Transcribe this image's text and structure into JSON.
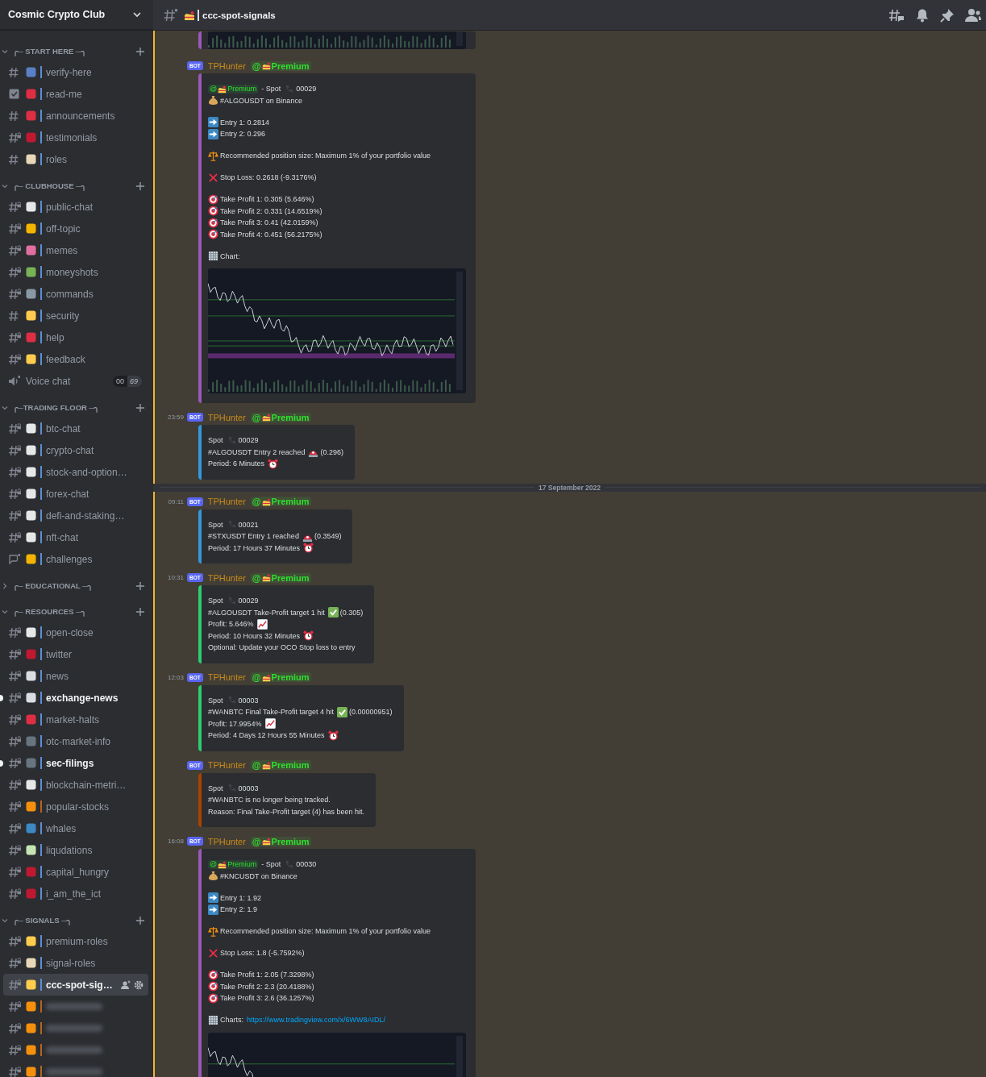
{
  "server": {
    "name": "Cosmic Crypto Club"
  },
  "sidebar": {
    "categories": [
      {
        "name": "╭─ START HERE ─╮",
        "expanded": true,
        "channels": [
          {
            "kind": "text",
            "name": "verify-here",
            "private": false,
            "unread": false,
            "selected": false
          },
          {
            "kind": "rules",
            "name": "read-me",
            "unread": false,
            "selected": false
          },
          {
            "kind": "text",
            "name": "announcements",
            "private": false,
            "unread": false,
            "selected": false
          },
          {
            "kind": "text",
            "name": "testimonials",
            "private": true,
            "unread": false,
            "selected": false
          },
          {
            "kind": "text",
            "name": "roles",
            "private": false,
            "unread": false,
            "selected": false
          }
        ]
      },
      {
        "name": "╭─ CLUBHOUSE ─╮",
        "expanded": true,
        "channels": [
          {
            "kind": "text",
            "name": "public-chat",
            "private": true,
            "unread": false,
            "selected": false
          },
          {
            "kind": "text",
            "name": "off-topic",
            "private": true,
            "unread": false,
            "selected": false
          },
          {
            "kind": "text",
            "name": "memes",
            "private": true,
            "unread": false,
            "selected": false
          },
          {
            "kind": "text",
            "name": "moneyshots",
            "private": true,
            "unread": false,
            "selected": false
          },
          {
            "kind": "text",
            "name": "commands",
            "private": true,
            "unread": false,
            "selected": false
          },
          {
            "kind": "text",
            "name": "security",
            "private": false,
            "unread": false,
            "selected": false
          },
          {
            "kind": "text",
            "name": "help",
            "private": true,
            "unread": false,
            "selected": false
          },
          {
            "kind": "text",
            "name": "feedback",
            "private": true,
            "unread": false,
            "selected": false
          },
          {
            "kind": "voice",
            "name": "Voice chat",
            "private": true,
            "unread": false,
            "selected": false,
            "user_count": "00",
            "user_limit": "69"
          }
        ]
      },
      {
        "name": "╭─TRADING FLOOR ─╮",
        "expanded": true,
        "channels": [
          {
            "kind": "text",
            "name": "btc-chat",
            "private": true,
            "unread": false,
            "selected": false
          },
          {
            "kind": "text",
            "name": "crypto-chat",
            "private": true,
            "unread": false,
            "selected": false
          },
          {
            "kind": "text",
            "name": "stock-and-option…",
            "private": true,
            "unread": false,
            "selected": false
          },
          {
            "kind": "text",
            "name": "forex-chat",
            "private": true,
            "unread": false,
            "selected": false
          },
          {
            "kind": "text",
            "name": "defi-and-staking…",
            "private": true,
            "unread": false,
            "selected": false
          },
          {
            "kind": "text",
            "name": "nft-chat",
            "private": true,
            "unread": false,
            "selected": false
          },
          {
            "kind": "forum",
            "name": "challenges",
            "private": true,
            "unread": false,
            "selected": false
          }
        ]
      },
      {
        "name": "╭─ EDUCATIONAL ─╮",
        "expanded": false
      },
      {
        "name": "╭─ RESOURCES ─╮",
        "expanded": true,
        "channels": [
          {
            "kind": "text",
            "name": "open-close",
            "private": true,
            "unread": false,
            "selected": false
          },
          {
            "kind": "text",
            "name": "twitter",
            "private": true,
            "unread": false,
            "selected": false
          },
          {
            "kind": "text",
            "name": "news",
            "private": true,
            "unread": false,
            "selected": false
          },
          {
            "kind": "text",
            "name": "exchange-news",
            "private": true,
            "unread": true,
            "selected": false
          },
          {
            "kind": "text",
            "name": "market-halts",
            "private": true,
            "unread": false,
            "selected": false
          },
          {
            "kind": "text",
            "name": "otc-market-info",
            "private": true,
            "unread": false,
            "selected": false
          },
          {
            "kind": "text",
            "name": "sec-filings",
            "private": true,
            "unread": true,
            "selected": false
          },
          {
            "kind": "text",
            "name": "blockchain-metri…",
            "private": true,
            "unread": false,
            "selected": false
          },
          {
            "kind": "text",
            "name": "popular-stocks",
            "private": true,
            "unread": false,
            "selected": false
          },
          {
            "kind": "text",
            "name": "whales",
            "private": true,
            "unread": false,
            "selected": false
          },
          {
            "kind": "text",
            "name": "liqudations",
            "private": true,
            "unread": false,
            "selected": false
          },
          {
            "kind": "text",
            "name": "capital_hungry",
            "private": true,
            "unread": false,
            "selected": false
          },
          {
            "kind": "text",
            "name": "i_am_the_ict",
            "private": true,
            "unread": false,
            "selected": false
          }
        ]
      },
      {
        "name": "╭─ SIGNALS ─╮",
        "expanded": true,
        "channels": [
          {
            "kind": "text",
            "name": "premium-roles",
            "private": true,
            "unread": false,
            "selected": false
          },
          {
            "kind": "text",
            "name": "signal-roles",
            "private": true,
            "unread": false,
            "selected": false
          },
          {
            "kind": "text",
            "name": "ccc-spot-sig…",
            "private": true,
            "unread": false,
            "selected": true
          },
          {
            "kind": "text",
            "blurred": true,
            "private": true,
            "unread": false,
            "selected": false
          },
          {
            "kind": "text",
            "blurred": true,
            "private": true,
            "unread": false,
            "selected": false
          },
          {
            "kind": "text",
            "blurred": true,
            "private": true,
            "unread": false,
            "selected": false
          },
          {
            "kind": "text",
            "blurred": true,
            "private": true,
            "unread": false,
            "selected": false
          }
        ]
      }
    ]
  },
  "channel_header": {
    "title": "ccc-spot-signals"
  },
  "messages": [
    {
      "kind": "fragment",
      "highlighted": true,
      "embed": {
        "color": "#9b59b6",
        "image": true
      }
    },
    {
      "kind": "message",
      "highlighted": true,
      "tag": "BOT",
      "author": "TPHunter",
      "role": {
        "at": "@",
        "label": "Premium"
      },
      "embed": {
        "color": "#9b59b6",
        "image": true,
        "lines": [
          {
            "segs": [
              {
                "kind": "mention",
                "at": "@",
                "label": "Premium"
              },
              {
                "kind": "text",
                "text": "- Spot"
              },
              {
                "kind": "call"
              },
              {
                "kind": "text",
                "text": "00029"
              }
            ]
          },
          {
            "segs": [
              {
                "kind": "asset"
              },
              {
                "kind": "text",
                "text": "#ALGOUSDT on Binance"
              }
            ]
          },
          {
            "spaced": true,
            "segs": [
              {
                "kind": "entry"
              },
              {
                "kind": "text",
                "text": "Entry 1: 0.2814"
              }
            ]
          },
          {
            "segs": [
              {
                "kind": "entry"
              },
              {
                "kind": "text",
                "text": "Entry 2: 0.296"
              }
            ]
          },
          {
            "spaced": true,
            "segs": [
              {
                "kind": "size"
              },
              {
                "kind": "text",
                "text": "Recommended position size: Maximum 1% of your portfolio value"
              }
            ]
          },
          {
            "spaced": true,
            "segs": [
              {
                "kind": "stop"
              },
              {
                "kind": "text",
                "text": "Stop Loss: 0.2618 (-9.3176%)"
              }
            ]
          },
          {
            "spaced": true,
            "segs": [
              {
                "kind": "target"
              },
              {
                "kind": "text",
                "text": "Take Profit 1: 0.305 (5.646%)"
              }
            ]
          },
          {
            "segs": [
              {
                "kind": "target"
              },
              {
                "kind": "text",
                "text": "Take Profit 2: 0.331 (14.6519%)"
              }
            ]
          },
          {
            "segs": [
              {
                "kind": "target"
              },
              {
                "kind": "text",
                "text": "Take Profit 3: 0.41 (42.0159%)"
              }
            ]
          },
          {
            "segs": [
              {
                "kind": "target"
              },
              {
                "kind": "text",
                "text": "Take Profit 4: 0.451 (56.2175%)"
              }
            ]
          },
          {
            "spaced": true,
            "segs": [
              {
                "kind": "chart"
              },
              {
                "kind": "text",
                "text": "Chart:"
              }
            ]
          }
        ]
      }
    },
    {
      "kind": "message",
      "highlighted": true,
      "time": "23:59",
      "tag": "BOT",
      "author": "TPHunter",
      "role": {
        "at": "@",
        "label": "Premium"
      },
      "embed": {
        "color": "#3498db",
        "lines": [
          {
            "segs": [
              {
                "kind": "text",
                "text": "Spot"
              },
              {
                "kind": "call"
              },
              {
                "kind": "text",
                "text": "00029"
              }
            ]
          },
          {
            "segs": [
              {
                "kind": "text",
                "text": "#ALGOUSDT Entry 2 reached"
              },
              {
                "kind": "alert"
              },
              {
                "kind": "text",
                "text": "(0.296)"
              }
            ]
          },
          {
            "segs": [
              {
                "kind": "text",
                "text": "Period: 6 Minutes"
              },
              {
                "kind": "timer"
              }
            ]
          }
        ]
      }
    },
    {
      "kind": "date",
      "text": "17 September 2022"
    },
    {
      "kind": "message",
      "highlighted": true,
      "time": "09:11",
      "tag": "BOT",
      "author": "TPHunter",
      "role": {
        "at": "@",
        "label": "Premium"
      },
      "embed": {
        "color": "#3498db",
        "lines": [
          {
            "segs": [
              {
                "kind": "text",
                "text": "Spot"
              },
              {
                "kind": "call"
              },
              {
                "kind": "text",
                "text": "00021"
              }
            ]
          },
          {
            "segs": [
              {
                "kind": "text",
                "text": "#STXUSDT Entry 1 reached"
              },
              {
                "kind": "alert"
              },
              {
                "kind": "text",
                "text": "(0.3549)"
              }
            ]
          },
          {
            "segs": [
              {
                "kind": "text",
                "text": "Period: 17 Hours 37 Minutes"
              },
              {
                "kind": "timer"
              }
            ]
          }
        ]
      }
    },
    {
      "kind": "message",
      "highlighted": true,
      "time": "10:31",
      "tag": "BOT",
      "author": "TPHunter",
      "role": {
        "at": "@",
        "label": "Premium"
      },
      "embed": {
        "color": "#2ecc71",
        "lines": [
          {
            "segs": [
              {
                "kind": "text",
                "text": "Spot"
              },
              {
                "kind": "call"
              },
              {
                "kind": "text",
                "text": "00029"
              }
            ]
          },
          {
            "segs": [
              {
                "kind": "text",
                "text": "#ALGOUSDT Take-Profit target 1 hit"
              },
              {
                "kind": "hit"
              },
              {
                "kind": "text",
                "text": "(0.305)"
              }
            ]
          },
          {
            "segs": [
              {
                "kind": "text",
                "text": "Profit: 5.646%"
              },
              {
                "kind": "profit"
              }
            ]
          },
          {
            "segs": [
              {
                "kind": "text",
                "text": "Period: 10 Hours 32 Minutes"
              },
              {
                "kind": "timer"
              }
            ]
          },
          {
            "segs": [
              {
                "kind": "text",
                "text": "Optional: Update your OCO Stop loss to entry"
              }
            ]
          }
        ]
      }
    },
    {
      "kind": "message",
      "highlighted": true,
      "time": "12:03",
      "tag": "BOT",
      "author": "TPHunter",
      "role": {
        "at": "@",
        "label": "Premium"
      },
      "embed": {
        "color": "#2ecc71",
        "lines": [
          {
            "segs": [
              {
                "kind": "text",
                "text": "Spot"
              },
              {
                "kind": "call"
              },
              {
                "kind": "text",
                "text": "00003"
              }
            ]
          },
          {
            "segs": [
              {
                "kind": "text",
                "text": "#WANBTC Final Take-Profit target 4 hit"
              },
              {
                "kind": "hit"
              },
              {
                "kind": "text",
                "text": "(0.00000951)"
              }
            ]
          },
          {
            "segs": [
              {
                "kind": "text",
                "text": "Profit: 17.9954%"
              },
              {
                "kind": "profit"
              }
            ]
          },
          {
            "segs": [
              {
                "kind": "text",
                "text": "Period: 4 Days 12 Hours 55 Minutes"
              },
              {
                "kind": "timer"
              }
            ]
          }
        ]
      }
    },
    {
      "kind": "message",
      "highlighted": true,
      "tag": "BOT",
      "author": "TPHunter",
      "role": {
        "at": "@",
        "label": "Premium"
      },
      "embed": {
        "color": "#a84300",
        "lines": [
          {
            "segs": [
              {
                "kind": "text",
                "text": "Spot"
              },
              {
                "kind": "call"
              },
              {
                "kind": "text",
                "text": "00003"
              }
            ]
          },
          {
            "segs": [
              {
                "kind": "text",
                "text": "#WANBTC is no longer being tracked."
              }
            ]
          },
          {
            "segs": [
              {
                "kind": "text",
                "text": "Reason: Final Take-Profit target (4) has been hit."
              }
            ]
          }
        ]
      }
    },
    {
      "kind": "message",
      "highlighted": true,
      "time": "16:08",
      "tag": "BOT",
      "author": "TPHunter",
      "role": {
        "at": "@",
        "label": "Premium"
      },
      "embed": {
        "color": "#9b59b6",
        "image": true,
        "lines": [
          {
            "segs": [
              {
                "kind": "mention",
                "at": "@",
                "label": "Premium"
              },
              {
                "kind": "text",
                "text": "- Spot"
              },
              {
                "kind": "call"
              },
              {
                "kind": "text",
                "text": "00030"
              }
            ]
          },
          {
            "segs": [
              {
                "kind": "asset"
              },
              {
                "kind": "text",
                "text": "#KNCUSDT on Binance"
              }
            ]
          },
          {
            "spaced": true,
            "segs": [
              {
                "kind": "entry"
              },
              {
                "kind": "text",
                "text": "Entry 1: 1.92"
              }
            ]
          },
          {
            "segs": [
              {
                "kind": "entry"
              },
              {
                "kind": "text",
                "text": "Entry 2: 1.9"
              }
            ]
          },
          {
            "spaced": true,
            "segs": [
              {
                "kind": "size"
              },
              {
                "kind": "text",
                "text": "Recommended position size: Maximum 1% of your portfolio value"
              }
            ]
          },
          {
            "spaced": true,
            "segs": [
              {
                "kind": "stop"
              },
              {
                "kind": "text",
                "text": "Stop Loss: 1.8 (-5.7592%)"
              }
            ]
          },
          {
            "spaced": true,
            "segs": [
              {
                "kind": "target"
              },
              {
                "kind": "text",
                "text": "Take Profit 1: 2.05 (7.3298%)"
              }
            ]
          },
          {
            "segs": [
              {
                "kind": "target"
              },
              {
                "kind": "text",
                "text": "Take Profit 2: 2.3 (20.4188%)"
              }
            ]
          },
          {
            "segs": [
              {
                "kind": "target"
              },
              {
                "kind": "text",
                "text": "Take Profit 3: 2.6 (36.1257%)"
              }
            ]
          },
          {
            "spaced": true,
            "segs": [
              {
                "kind": "chart"
              },
              {
                "kind": "text",
                "text": "Charts:"
              },
              {
                "kind": "link",
                "text": "https://www.tradingview.com/x/6WW8AIDL/"
              }
            ]
          }
        ]
      }
    }
  ]
}
